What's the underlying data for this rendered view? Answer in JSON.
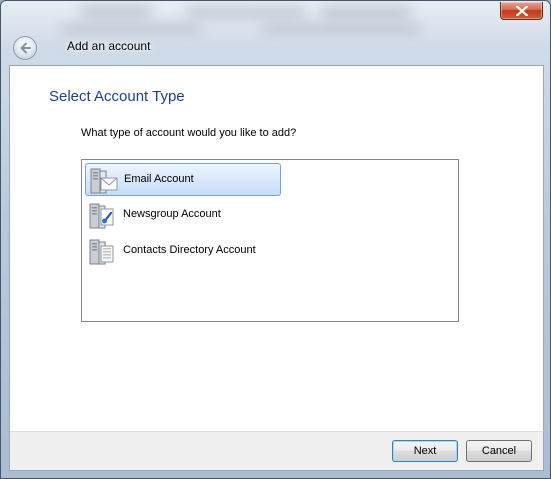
{
  "window": {
    "title": "Add an account"
  },
  "page": {
    "heading": "Select Account Type",
    "question": "What type of account would you like to add?"
  },
  "account_types": [
    {
      "label": "Email Account",
      "icon": "email-account-icon",
      "selected": true
    },
    {
      "label": "Newsgroup Account",
      "icon": "newsgroup-account-icon",
      "selected": false
    },
    {
      "label": "Contacts Directory Account",
      "icon": "contacts-directory-icon",
      "selected": false
    }
  ],
  "buttons": {
    "next": "Next",
    "cancel": "Cancel"
  },
  "colors": {
    "heading": "#1f3f8f",
    "selection_bg": "#d7e7fb",
    "selection_border": "#7da2ce",
    "close_button": "#c2391b"
  }
}
